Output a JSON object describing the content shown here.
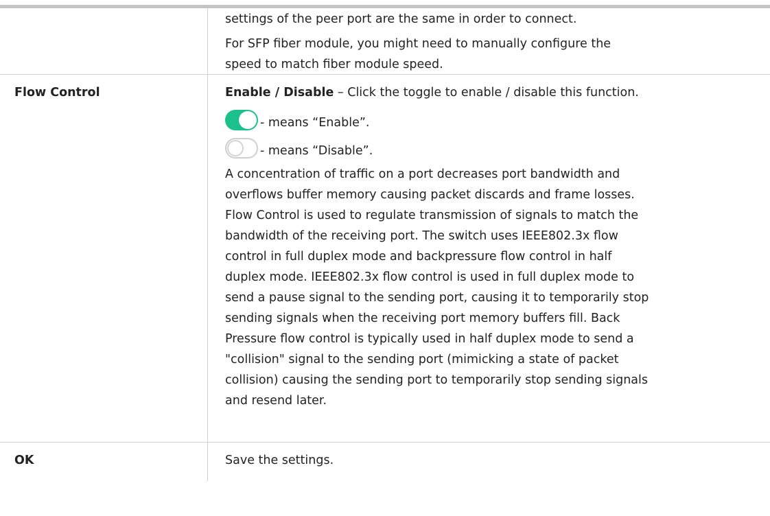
{
  "rows": [
    {
      "label": "",
      "paragraphs": [
        "settings of the peer port are the same in order to connect.",
        "For SFP fiber module, you might need to manually configure the\nspeed to match fiber module speed."
      ]
    },
    {
      "label": "Flow Control",
      "lead_bold": "Enable / Disable",
      "lead_rest": " – Click the toggle to enable / disable this function.",
      "toggle_on_text": "- means “Enable”.",
      "toggle_off_text": "- means “Disable”.",
      "body": "A concentration of traffic on a port decreases port bandwidth and\noverflows buffer memory causing packet discards and frame losses.\nFlow Control is used to regulate transmission of signals to match the\nbandwidth of the receiving port. The switch uses IEEE802.3x flow\ncontrol in full duplex mode and backpressure flow control in half\nduplex mode. IEEE802.3x flow control is used in full duplex mode to\nsend a pause signal to the sending port, causing it to temporarily stop\nsending signals when the receiving port memory buffers fill. Back\nPressure flow control is typically used in half duplex mode to send a\n\"collision\" signal to the sending port (mimicking a state of packet\ncollision) causing the sending port to temporarily stop sending signals\nand resend later."
    },
    {
      "label": "OK",
      "text": "Save the settings."
    }
  ],
  "colors": {
    "toggle_on": "#1cc08a",
    "border": "#cfcfcf",
    "top_rule": "#c4c4c4"
  },
  "icons": {
    "toggle_on": "toggle-switch-on-icon",
    "toggle_off": "toggle-switch-off-icon"
  }
}
